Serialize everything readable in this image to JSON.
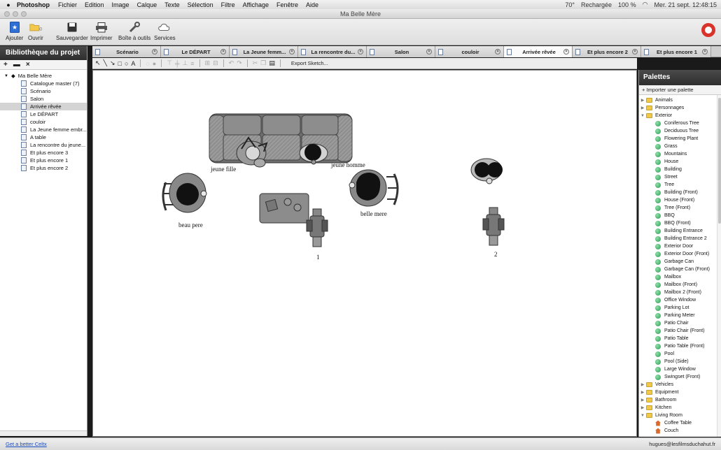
{
  "menubar": {
    "app": "Photoshop",
    "items": [
      "Fichier",
      "Edition",
      "Image",
      "Calque",
      "Texte",
      "Sélection",
      "Filtre",
      "Affichage",
      "Fenêtre",
      "Aide"
    ],
    "status": {
      "temp": "70°",
      "sync": "Rechargée",
      "battery": "100 %",
      "clock": "Mer. 21 sept. 12:48:15"
    }
  },
  "window": {
    "title": "Ma Belle Mère"
  },
  "toolbar": {
    "add": "Ajouter",
    "open": "Ouvrir",
    "save": "Sauvegarder",
    "print": "Imprimer",
    "toolbox": "Boîte à outils",
    "services": "Services"
  },
  "left_panel": {
    "title": "Bibliothèque du projet",
    "root": "Ma Belle Mère",
    "items": [
      {
        "label": "Catalogue master (7)"
      },
      {
        "label": "Scénario"
      },
      {
        "label": "Salon"
      },
      {
        "label": "Arrivée rêvée"
      },
      {
        "label": "Le DÉPART"
      },
      {
        "label": "couloir"
      },
      {
        "label": "La Jeune femme embr..."
      },
      {
        "label": "A table"
      },
      {
        "label": "La rencontre du jeune..."
      },
      {
        "label": "Et plus encore 3"
      },
      {
        "label": "Et plus encore 1"
      },
      {
        "label": "Et plus encore 2"
      }
    ],
    "selected_index": 3
  },
  "tabs": [
    {
      "label": "Scénario"
    },
    {
      "label": "Le DÉPART"
    },
    {
      "label": "La Jeune femm..."
    },
    {
      "label": "La rencontre du..."
    },
    {
      "label": "Salon"
    },
    {
      "label": "couloir"
    },
    {
      "label": "Arrivée rêvée"
    },
    {
      "label": "Et plus encore 2"
    },
    {
      "label": "Et plus encore 1"
    }
  ],
  "active_tab": 6,
  "draw_toolbar": {
    "export": "Export Sketch..."
  },
  "canvas": {
    "labels": {
      "jeune_fille": "jeune fille",
      "jeune_homme": "jeune homme",
      "beau_pere": "beau pere",
      "belle_mere": "belle mere",
      "camera1": "1",
      "camera2": "2"
    }
  },
  "palettes": {
    "title": "Palettes",
    "import": "+ Importer une palette",
    "items": [
      {
        "label": "Animals",
        "kind": "folder",
        "open": false
      },
      {
        "label": "Personnages",
        "kind": "folder",
        "open": false
      },
      {
        "label": "Exterior",
        "kind": "folder",
        "open": true
      },
      {
        "label": "Coniferous Tree",
        "kind": "item"
      },
      {
        "label": "Deciduous Tree",
        "kind": "item"
      },
      {
        "label": "Flowering Plant",
        "kind": "item"
      },
      {
        "label": "Grass",
        "kind": "item"
      },
      {
        "label": "Mountains",
        "kind": "item"
      },
      {
        "label": "House",
        "kind": "item"
      },
      {
        "label": "Building",
        "kind": "item"
      },
      {
        "label": "Street",
        "kind": "item"
      },
      {
        "label": "Tree",
        "kind": "item"
      },
      {
        "label": "Building (Front)",
        "kind": "item"
      },
      {
        "label": "House (Front)",
        "kind": "item"
      },
      {
        "label": "Tree (Front)",
        "kind": "item"
      },
      {
        "label": "BBQ",
        "kind": "item"
      },
      {
        "label": "BBQ (Front)",
        "kind": "item"
      },
      {
        "label": "Building Entrance",
        "kind": "item"
      },
      {
        "label": "Building Entrance 2",
        "kind": "item"
      },
      {
        "label": "Exterior Door",
        "kind": "item"
      },
      {
        "label": "Exterior Door (Front)",
        "kind": "item"
      },
      {
        "label": "Garbage Can",
        "kind": "item"
      },
      {
        "label": "Garbage Can (Front)",
        "kind": "item"
      },
      {
        "label": "Mailbox",
        "kind": "item"
      },
      {
        "label": "Mailbox (Front)",
        "kind": "item"
      },
      {
        "label": "Mailbox 2 (Front)",
        "kind": "item"
      },
      {
        "label": "Office Window",
        "kind": "item"
      },
      {
        "label": "Parking Lot",
        "kind": "item"
      },
      {
        "label": "Parking Meter",
        "kind": "item"
      },
      {
        "label": "Patio Chair",
        "kind": "item"
      },
      {
        "label": "Patio Chair (Front)",
        "kind": "item"
      },
      {
        "label": "Patio Table",
        "kind": "item"
      },
      {
        "label": "Patio Table (Front)",
        "kind": "item"
      },
      {
        "label": "Pool",
        "kind": "item"
      },
      {
        "label": "Pool (Side)",
        "kind": "item"
      },
      {
        "label": "Large Window",
        "kind": "item"
      },
      {
        "label": "Swingset (Front)",
        "kind": "item"
      },
      {
        "label": "Vehicles",
        "kind": "folder",
        "open": false
      },
      {
        "label": "Equipment",
        "kind": "folder",
        "open": false
      },
      {
        "label": "Bathroom",
        "kind": "folder",
        "open": false
      },
      {
        "label": "Kitchen",
        "kind": "folder",
        "open": false
      },
      {
        "label": "Living Room",
        "kind": "folder",
        "open": true
      },
      {
        "label": "Coffee Table",
        "kind": "living"
      },
      {
        "label": "Couch",
        "kind": "living"
      }
    ]
  },
  "status_bar": {
    "link": "Get a better Celtx",
    "user": "hugues@lesfilmsduchahut.fr"
  }
}
